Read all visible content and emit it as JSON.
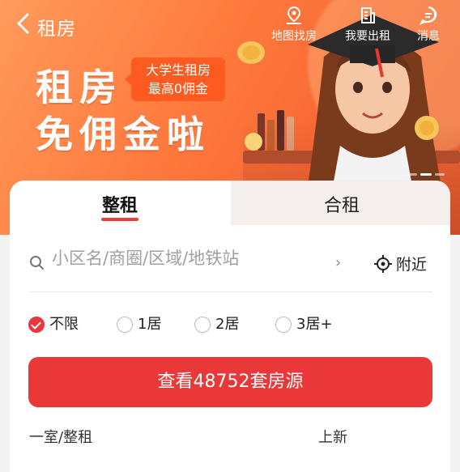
{
  "nav": {
    "title": "租房",
    "actions": [
      {
        "label": "地图找房",
        "icon": "map-pin-icon"
      },
      {
        "label": "我要出租",
        "icon": "building-icon"
      },
      {
        "label": "消息",
        "icon": "message-icon"
      }
    ]
  },
  "banner": {
    "headline_line1": "租房",
    "headline_line2": "免佣金啦",
    "promo_line1": "大学生租房",
    "promo_line2": "最高0佣金",
    "slides": 3,
    "active_slide": 1
  },
  "tabs": [
    {
      "label": "整租",
      "active": true
    },
    {
      "label": "合租",
      "active": false
    }
  ],
  "search": {
    "placeholder": "小区名/商圈/区域/地铁站",
    "nearby_label": "附近"
  },
  "room_filters": [
    {
      "label": "不限",
      "checked": true
    },
    {
      "label": "1居",
      "checked": false
    },
    {
      "label": "2居",
      "checked": false
    },
    {
      "label": "3居+",
      "checked": false
    }
  ],
  "cta_label": "查看48752套房源",
  "bottom": {
    "left": "一室/整租",
    "right": "上新"
  },
  "colors": {
    "accent": "#ea3838",
    "banner": "#ff7b3e",
    "promo": "#ff5a1f"
  }
}
